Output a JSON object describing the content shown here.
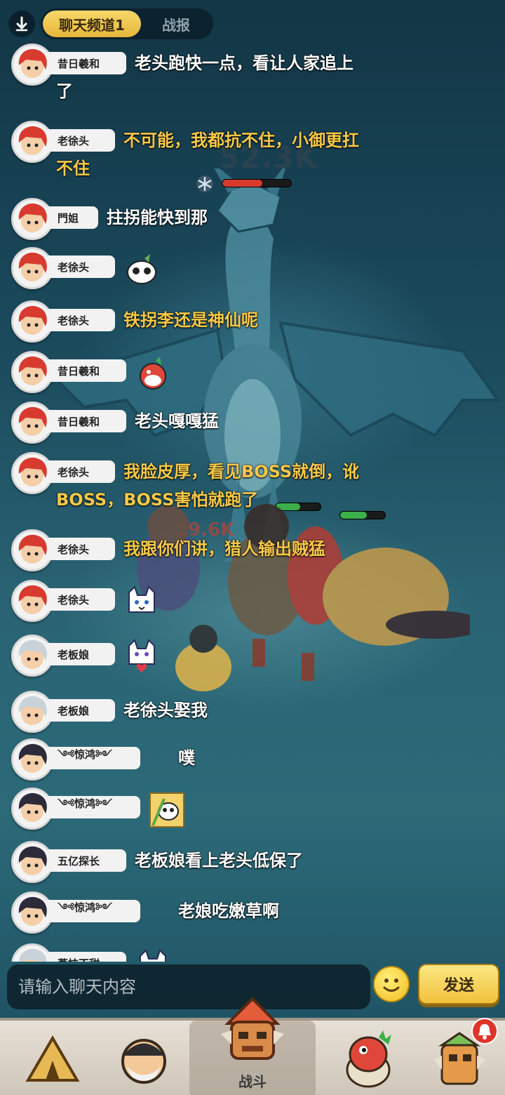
{
  "tabs": {
    "active": "聊天频道1",
    "inactive": "战报"
  },
  "battle": {
    "boss_hp": "52.3K",
    "floating_damage": "19.6K"
  },
  "messages": [
    {
      "name": "昔日羲和",
      "text_l1": "老头跑快一点，看让人家追上",
      "text_l2": "了",
      "color": "white",
      "hair": "red"
    },
    {
      "name": "老徐头",
      "text_l1": "不可能，我都抗不住，小御更扛",
      "text_l2": "不住",
      "color": "gold",
      "hair": "red"
    },
    {
      "name": "門姐",
      "text_l1": "拄拐能快到那",
      "color": "white",
      "hair": "red"
    },
    {
      "name": "老徐头",
      "sticker": "panda-sticker",
      "hair": "red"
    },
    {
      "name": "老徐头",
      "text_l1": "铁拐李还是神仙呢",
      "color": "gold",
      "hair": "red"
    },
    {
      "name": "昔日羲和",
      "sticker": "dragon-sticker",
      "hair": "red"
    },
    {
      "name": "昔日羲和",
      "text_l1": "老头嘎嘎猛",
      "color": "white",
      "hair": "red"
    },
    {
      "name": "老徐头",
      "text_l1": "我脸皮厚，看见BOSS就倒，讹",
      "text_l2": "BOSS，BOSS害怕就跑了",
      "color": "gold",
      "hair": "red"
    },
    {
      "name": "老徐头",
      "text_l1": "我跟你们讲，猎人输出贼猛",
      "color": "gold",
      "hair": "red"
    },
    {
      "name": "老徐头",
      "sticker": "cat-sticker",
      "hair": "red"
    },
    {
      "name": "老板娘",
      "sticker": "cat-heart-sticker",
      "hair": "silver"
    },
    {
      "name": "老板娘",
      "text_l1": "老徐头娶我",
      "color": "white",
      "hair": "silver"
    },
    {
      "name": "༺惊鸿༻",
      "text_l1": "噗",
      "color": "white",
      "hair": "dark"
    },
    {
      "name": "༺惊鸿༻",
      "sticker": "bamboo-sticker",
      "hair": "dark"
    },
    {
      "name": "五亿探长",
      "text_l1": "老板娘看上老头低保了",
      "color": "white",
      "hair": "dark"
    },
    {
      "name": "༺惊鸿༻",
      "text_l1": "老娘吃嫩草啊",
      "color": "white",
      "hair": "dark"
    },
    {
      "name": "荔枝不甜",
      "sticker": "cat-sticker",
      "hair": "silver"
    }
  ],
  "input": {
    "placeholder": "请输入聊天内容",
    "send_label": "发送"
  },
  "nav": {
    "battle_label": "战斗"
  },
  "colors": {
    "gold": "#f7c948",
    "accent": "#e7b63a"
  }
}
